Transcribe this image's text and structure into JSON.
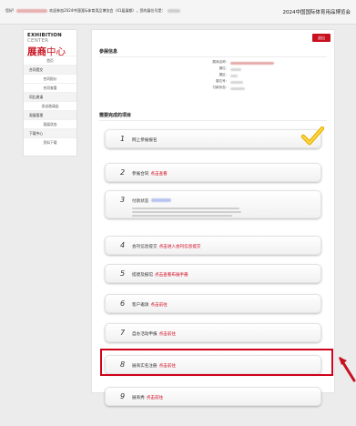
{
  "topbar": {
    "greet_prefix": "您好!",
    "greet_mid": "欢迎参加2024中国国际体育用品博览会（41届展都），您的展位号是：",
    "fair_title": "2024中国国际体育用品博览会"
  },
  "sidebar": {
    "brand_en": "EXHIBITION",
    "brand_en_2": "CENTER",
    "brand_cn_1": "展商",
    "brand_cn_2": "中心",
    "items": [
      {
        "label": "首页",
        "group": false
      },
      {
        "label": "合同提交",
        "group": true
      },
      {
        "label": "合同报价",
        "group": false
      },
      {
        "label": "合同查看",
        "group": false
      },
      {
        "label": "同比邀请",
        "group": true
      },
      {
        "label": "发送邀请函",
        "group": false
      },
      {
        "label": "观展管理",
        "group": true
      },
      {
        "label": "观展状态",
        "group": false
      },
      {
        "label": "下载中心",
        "group": true
      },
      {
        "label": "资料下载",
        "group": false
      }
    ]
  },
  "main": {
    "exit_label": "退出",
    "info_title": "参展信息",
    "info_rows": [
      {
        "key": "展商名称:"
      },
      {
        "key": "展位:"
      },
      {
        "key": "展区:"
      },
      {
        "key": "展位号:"
      },
      {
        "key": "付款状态:"
      }
    ],
    "todo_title": "需要完成的项目",
    "tasks": [
      {
        "num": "1",
        "name": "网上参展报名",
        "action": ""
      },
      {
        "num": "2",
        "name": "参展合同",
        "action": "点击查看"
      },
      {
        "num": "3",
        "name": "付款状态",
        "action": ""
      },
      {
        "num": "4",
        "name": "会刊信息提交",
        "action": "点击进入会刊信息提交"
      },
      {
        "num": "5",
        "name": "搭建及报馆",
        "action": "点击查看布展手册"
      },
      {
        "num": "6",
        "name": "客户邀请",
        "action": "点击前往"
      },
      {
        "num": "7",
        "name": "自办活动申报",
        "action": "点击前往"
      },
      {
        "num": "8",
        "name": "展商实名注册",
        "action": "点击前往"
      },
      {
        "num": "9",
        "name": "展商秀",
        "action": "点击前往"
      }
    ]
  },
  "colors": {
    "accent": "#c8101f",
    "link": "#d0021b",
    "highlight": "#d0021b"
  },
  "icons": {
    "complete": "checkmark-icon",
    "pointer": "arrow-icon"
  }
}
